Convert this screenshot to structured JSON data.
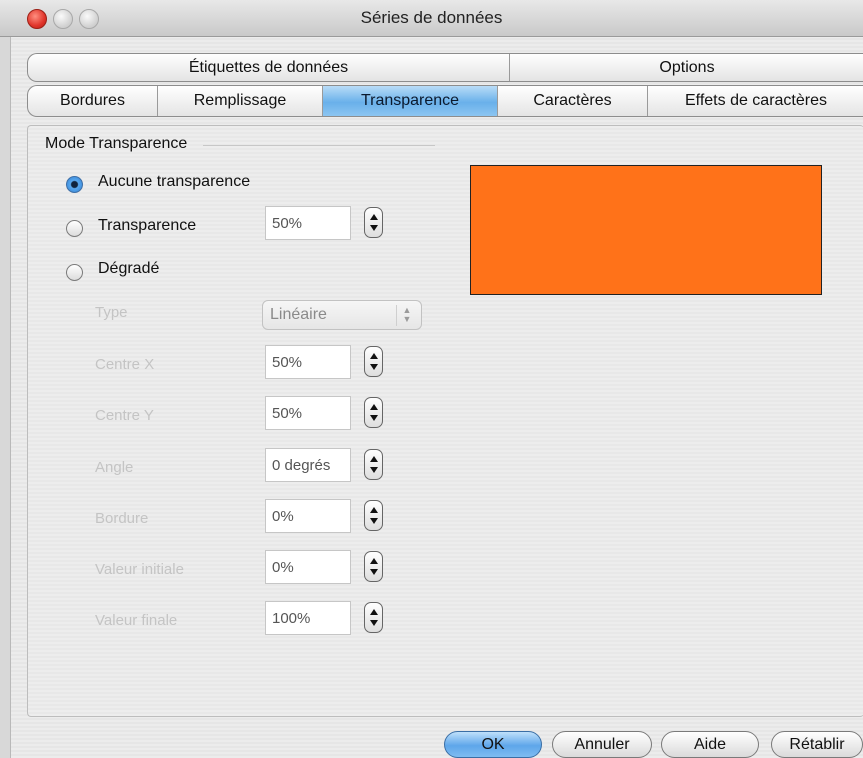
{
  "window": {
    "title": "Séries de données"
  },
  "tabs_row1": [
    {
      "label": "Étiquettes de données"
    },
    {
      "label": "Options"
    }
  ],
  "tabs_row2": [
    {
      "label": "Bordures"
    },
    {
      "label": "Remplissage"
    },
    {
      "label": "Transparence",
      "active": true
    },
    {
      "label": "Caractères"
    },
    {
      "label": "Effets de caractères"
    }
  ],
  "transparency": {
    "section_label": "Mode Transparence",
    "options": [
      {
        "label": "Aucune transparence",
        "checked": true
      },
      {
        "label": "Transparence",
        "checked": false,
        "value": "50%"
      },
      {
        "label": "Dégradé",
        "checked": false
      }
    ]
  },
  "gradient": {
    "type_label": "Type",
    "type_value": "Linéaire",
    "fields": [
      {
        "label": "Centre X",
        "value": "50%"
      },
      {
        "label": "Centre Y",
        "value": "50%"
      },
      {
        "label": "Angle",
        "value": "0 degrés"
      },
      {
        "label": "Bordure",
        "value": "0%"
      },
      {
        "label": "Valeur initiale",
        "value": "0%"
      },
      {
        "label": "Valeur finale",
        "value": "100%"
      }
    ]
  },
  "preview": {
    "color": "#ff7219"
  },
  "buttons": {
    "ok": "OK",
    "cancel": "Annuler",
    "help": "Aide",
    "reset": "Rétablir"
  },
  "colors": {
    "accent": "#5ea6ea",
    "disabled_text": "#c4c4c4"
  }
}
